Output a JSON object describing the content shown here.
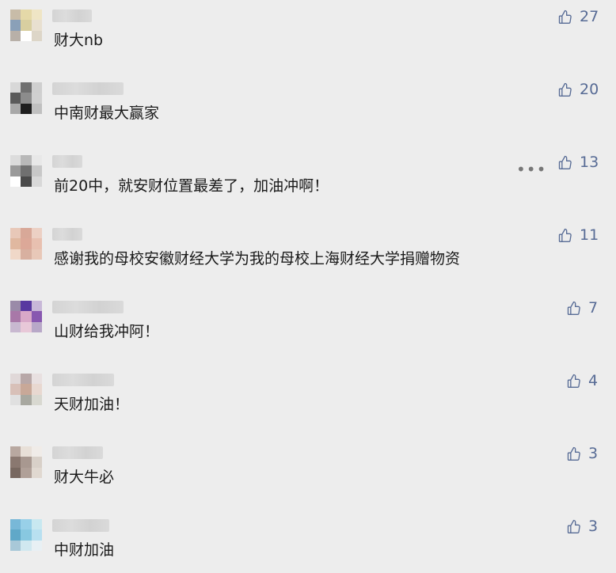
{
  "comments": [
    {
      "text": "财大nb",
      "likes": "27",
      "avatar": [
        "#c8bca8",
        "#e5d9a8",
        "#efe5c5",
        "#8aa0b8",
        "#d8cfa0",
        "#e8e0d0",
        "#b8b0a8",
        "#ffffff",
        "#ddd6c8"
      ],
      "name_w": 50
    },
    {
      "text": "中南财最大赢家",
      "likes": "20",
      "avatar": [
        "#d8d8d8",
        "#707070",
        "#cfcfcf",
        "#5a5a5a",
        "#8c8c8c",
        "#d0d0d0",
        "#a8a8a8",
        "#1e1e1e",
        "#c0c0c0"
      ],
      "name_w": 90
    },
    {
      "text": "前20中，就安财位置最差了，加油冲啊！",
      "likes": "13",
      "avatar": [
        "#dcdcdc",
        "#b8b8b8",
        "#e8e8e8",
        "#9a9a9a",
        "#707070",
        "#c8c8c8",
        "#ffffff",
        "#4a4a4a",
        "#d8d8d8"
      ],
      "name_w": 38,
      "more": "•••"
    },
    {
      "text": "感谢我的母校安徽财经大学为我的母校上海财经大学捐赠物资",
      "likes": "11",
      "avatar": [
        "#e8c8b8",
        "#d8a898",
        "#ecd0c4",
        "#e0b8a0",
        "#dca898",
        "#e8c0b0",
        "#f0d8c8",
        "#d8b0a0",
        "#e8c8b8"
      ],
      "name_w": 38
    },
    {
      "text": "山财给我冲阿！",
      "likes": "7",
      "avatar": [
        "#9a8aa8",
        "#5838a0",
        "#c8b8d8",
        "#a878a8",
        "#d8a8c8",
        "#8858b0",
        "#c8b8d0",
        "#e8c8d8",
        "#b8a8c8"
      ],
      "name_w": 90
    },
    {
      "text": "天财加油！",
      "likes": "4",
      "avatar": [
        "#e0d8d8",
        "#b8a8a8",
        "#e8e0e0",
        "#d8c0b8",
        "#c8a898",
        "#e8d8d0",
        "#e0e0e0",
        "#a8a8a0",
        "#d8d8d0"
      ],
      "name_w": 78
    },
    {
      "text": "财大牛必",
      "likes": "3",
      "avatar": [
        "#b8a8a0",
        "#e8e0d8",
        "#f0ece8",
        "#8a7870",
        "#a89890",
        "#d8d0c8",
        "#786860",
        "#b0a098",
        "#e0d8d0"
      ],
      "name_w": 64
    },
    {
      "text": "中财加油",
      "likes": "3",
      "avatar": [
        "#78b8d8",
        "#98d0e8",
        "#c8e8f0",
        "#60a8c8",
        "#88c8e0",
        "#b8e0f0",
        "#a8c8d8",
        "#d0e8f0",
        "#e8f0f4"
      ],
      "name_w": 72
    }
  ],
  "icons": {
    "like": "thumbs-up-icon",
    "more": "more-icon"
  },
  "colors": {
    "accent": "#576b95",
    "background": "#ededed",
    "text": "#1a1a1a"
  }
}
